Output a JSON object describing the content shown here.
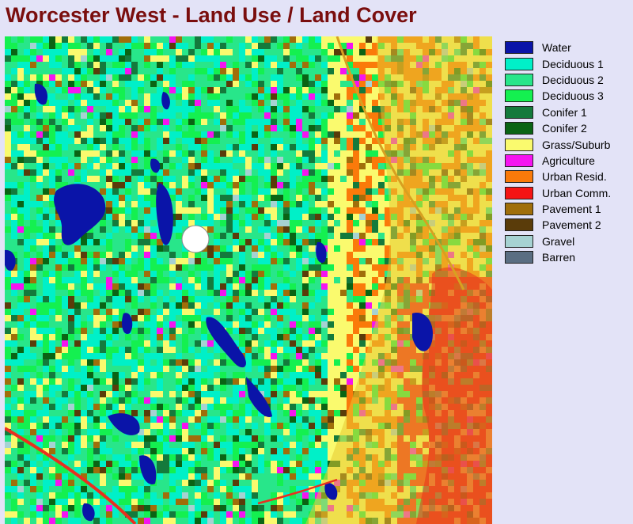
{
  "title": "Worcester West - Land Use / Land Cover",
  "legend": [
    {
      "label": "Water",
      "color": "#0a14a8"
    },
    {
      "label": "Deciduous 1",
      "color": "#00f0c8"
    },
    {
      "label": "Deciduous 2",
      "color": "#28e68a"
    },
    {
      "label": "Deciduous 3",
      "color": "#14f050"
    },
    {
      "label": "Conifer 1",
      "color": "#147a3c"
    },
    {
      "label": "Conifer 2",
      "color": "#0a6414"
    },
    {
      "label": "Grass/Suburb",
      "color": "#fafa6e"
    },
    {
      "label": "Agriculture",
      "color": "#f514f0"
    },
    {
      "label": "Urban Resid.",
      "color": "#fa7a0a"
    },
    {
      "label": "Urban Comm.",
      "color": "#f51414"
    },
    {
      "label": "Pavement 1",
      "color": "#a06e0a"
    },
    {
      "label": "Pavement 2",
      "color": "#5a3c0a"
    },
    {
      "label": "Gravel",
      "color": "#a6d2d2"
    },
    {
      "label": "Barren",
      "color": "#5a6e82"
    }
  ],
  "map": {
    "marker_color": "#ffffff"
  }
}
